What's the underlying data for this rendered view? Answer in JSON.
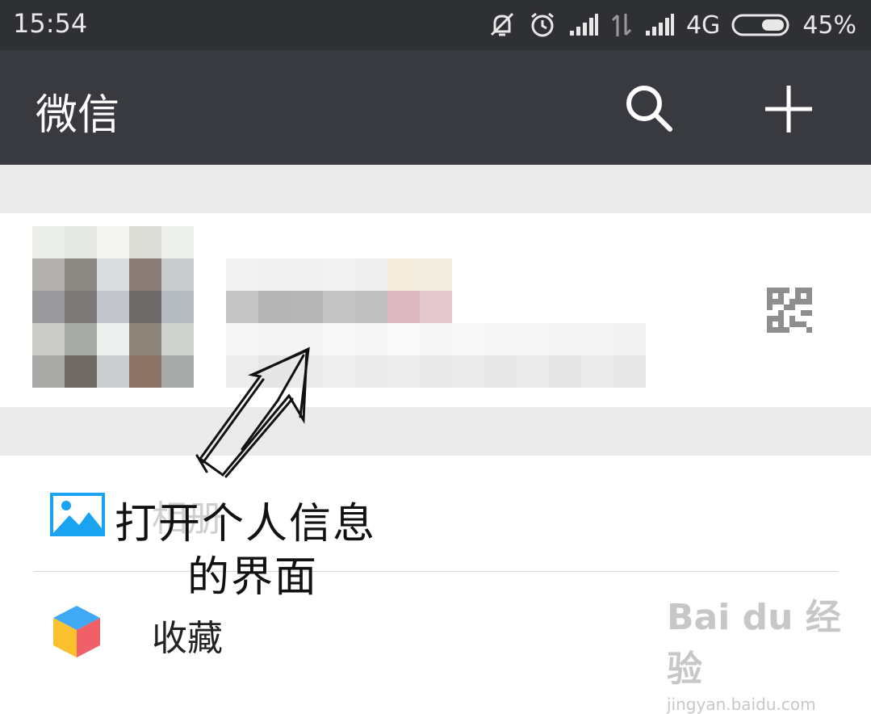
{
  "status_bar": {
    "time": "15:54",
    "network": "4G",
    "battery": "45%",
    "icons": [
      "mute-bell-icon",
      "alarm-icon",
      "signal-icon",
      "data-arrows-icon",
      "signal-icon",
      "battery-icon"
    ]
  },
  "app_bar": {
    "title": "微信",
    "icons": [
      "search-icon",
      "plus-icon"
    ]
  },
  "profile": {
    "qr_icon": "qr-code-icon"
  },
  "menu": {
    "items": [
      {
        "label": "相册",
        "icon": "photo-album-icon",
        "accent": "#1aa3f0"
      },
      {
        "label": "收藏",
        "icon": "favorites-cube-icon",
        "accent": "#3fa9f5"
      }
    ]
  },
  "annotation": {
    "line1": "打开个人信息",
    "line2": "的界面"
  },
  "watermark": {
    "brand": "Bai du 经验",
    "url": "jingyan.baidu.com"
  },
  "colors": {
    "status_bar_bg": "#2f3034",
    "app_bar_bg": "#393a3f",
    "section_gap": "#ebebeb"
  }
}
